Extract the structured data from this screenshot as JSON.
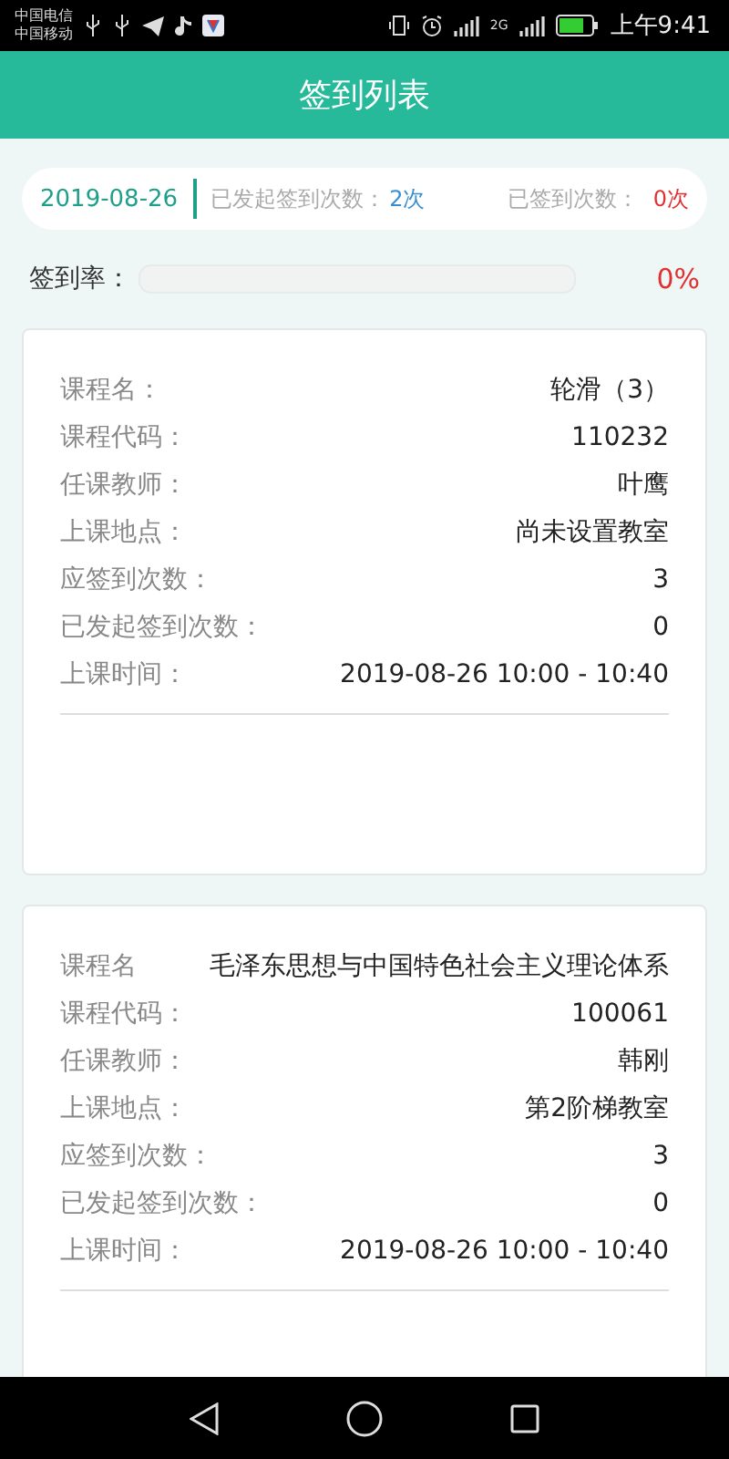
{
  "status_bar": {
    "carriers": [
      "中国电信",
      "中国移动"
    ],
    "network": "2G",
    "time": "上午9:41"
  },
  "header": {
    "title": "签到列表"
  },
  "summary": {
    "date": "2019-08-26",
    "started_label": "已发起签到次数：",
    "started_value": "2次",
    "signed_label": "已签到次数：",
    "signed_value": "0次"
  },
  "rate": {
    "label": "签到率：",
    "level": 0,
    "value": "0%"
  },
  "courses": [
    {
      "rows": [
        {
          "label": "课程名：",
          "value": "轮滑（3）"
        },
        {
          "label": "课程代码：",
          "value": "110232"
        },
        {
          "label": "任课教师：",
          "value": "叶鹰"
        },
        {
          "label": "上课地点：",
          "value": "尚未设置教室"
        },
        {
          "label": "应签到次数：",
          "value": "3"
        },
        {
          "label": "已发起签到次数：",
          "value": "0"
        },
        {
          "label": "上课时间：",
          "value": "2019-08-26 10:00 - 10:40"
        }
      ]
    },
    {
      "rows": [
        {
          "label": "课程名",
          "value": "毛泽东思想与中国特色社会主义理论体系"
        },
        {
          "label": "课程代码：",
          "value": "100061"
        },
        {
          "label": "任课教师：",
          "value": "韩刚"
        },
        {
          "label": "上课地点：",
          "value": "第2阶梯教室"
        },
        {
          "label": "应签到次数：",
          "value": "3"
        },
        {
          "label": "已发起签到次数：",
          "value": "0"
        },
        {
          "label": "上课时间：",
          "value": "2019-08-26 10:00 - 10:40"
        }
      ]
    }
  ]
}
